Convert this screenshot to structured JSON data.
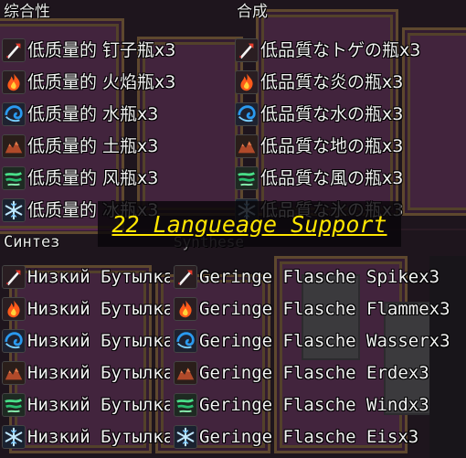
{
  "panels": {
    "zh": {
      "title": "综合性",
      "items": [
        {
          "label": "低质量的 钉子瓶x3",
          "icon": "spike-icon"
        },
        {
          "label": "低质量的 火焰瓶x3",
          "icon": "flame-icon"
        },
        {
          "label": "低质量的 水瓶x3",
          "icon": "water-icon"
        },
        {
          "label": "低质量的 土瓶x3",
          "icon": "earth-icon"
        },
        {
          "label": "低质量的 风瓶x3",
          "icon": "wind-icon"
        },
        {
          "label": "低质量的 冰瓶x3",
          "icon": "ice-icon"
        }
      ]
    },
    "ja": {
      "title": "合成",
      "items": [
        {
          "label": "低品質なトゲの瓶x3",
          "icon": "spike-icon"
        },
        {
          "label": "低品質な炎の瓶x3",
          "icon": "flame-icon"
        },
        {
          "label": "低品質な水の瓶x3",
          "icon": "water-icon"
        },
        {
          "label": "低品質な地の瓶x3",
          "icon": "earth-icon"
        },
        {
          "label": "低品質な風の瓶x3",
          "icon": "wind-icon"
        },
        {
          "label": "低品質な氷の瓶x3",
          "icon": "ice-icon"
        }
      ]
    },
    "ru": {
      "title": "Синтез",
      "items": [
        {
          "label": "Низкий Бутылка",
          "icon": "spike-icon"
        },
        {
          "label": "Низкий Бутылка",
          "icon": "flame-icon"
        },
        {
          "label": "Низкий Бутылка",
          "icon": "water-icon"
        },
        {
          "label": "Низкий Бутылка",
          "icon": "earth-icon"
        },
        {
          "label": "Низкий Бутылка",
          "icon": "wind-icon"
        },
        {
          "label": "Низкий Бутылка",
          "icon": "ice-icon"
        }
      ]
    },
    "de": {
      "title": "Synthese",
      "items": [
        {
          "label": "Geringe Flasche Spikex3",
          "icon": "spike-icon"
        },
        {
          "label": "Geringe Flasche Flammex3",
          "icon": "flame-icon"
        },
        {
          "label": "Geringe Flasche Wasserx3",
          "icon": "water-icon"
        },
        {
          "label": "Geringe Flasche Erdex3",
          "icon": "earth-icon"
        },
        {
          "label": "Geringe Flasche Windx3",
          "icon": "wind-icon"
        },
        {
          "label": "Geringe Flasche Eisx3",
          "icon": "ice-icon"
        }
      ]
    }
  },
  "banner": {
    "text": "22 Langueage Support"
  },
  "colors": {
    "banner_text": "#ffe600",
    "map_purple": "#7a3a6a",
    "map_trim": "#b98a4a"
  }
}
